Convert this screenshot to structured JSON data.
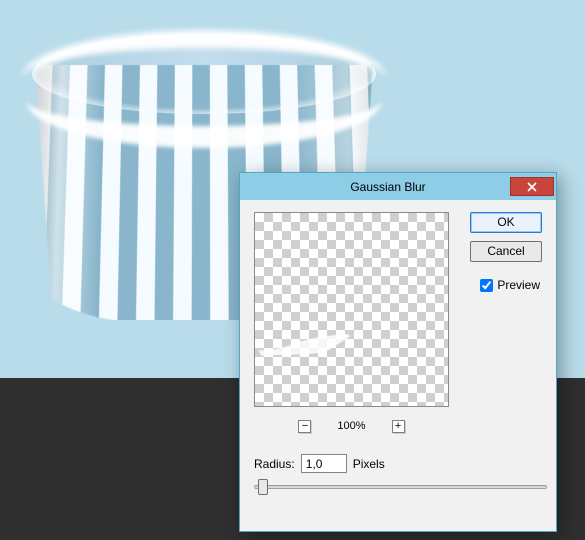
{
  "dialog": {
    "title": "Gaussian Blur",
    "ok_label": "OK",
    "cancel_label": "Cancel",
    "preview_label": "Preview",
    "preview_checked": true,
    "zoom": {
      "value": "100%",
      "out_glyph": "−",
      "in_glyph": "+"
    },
    "radius": {
      "label": "Radius:",
      "value": "1,0",
      "unit": "Pixels"
    },
    "close_glyph": "×"
  },
  "colors": {
    "titlebar": "#8dcde5",
    "close": "#c8453b",
    "ok_border": "#2a79d6"
  }
}
